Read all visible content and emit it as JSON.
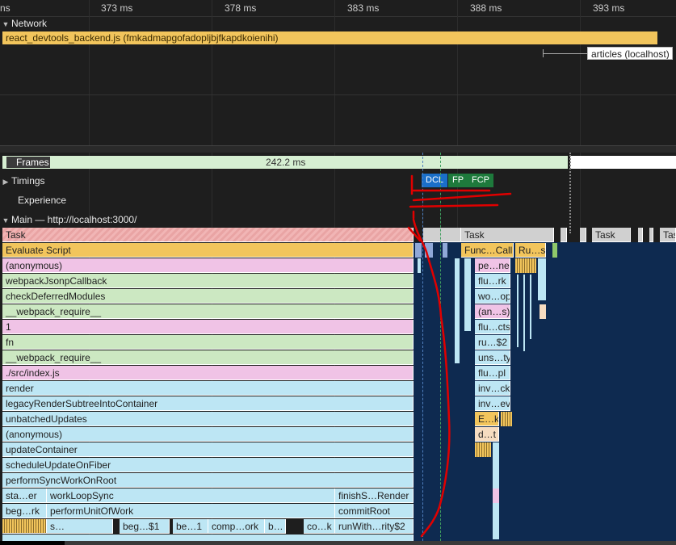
{
  "ruler": {
    "ticks": [
      "ns",
      "373 ms",
      "378 ms",
      "383 ms",
      "388 ms",
      "393 ms"
    ]
  },
  "network": {
    "title": "Network",
    "requests": [
      "react_devtools_backend.js (fmkadmapgofadopljbjfkapdkoienihi)",
      "articles (localhost)"
    ]
  },
  "frames": {
    "label": "Frames",
    "duration": "242.2 ms"
  },
  "timings": {
    "label": "Timings",
    "markers": [
      "DCL",
      "FP",
      "FCP"
    ]
  },
  "experience": {
    "label": "Experience"
  },
  "main": {
    "title": "Main — http://localhost:3000/",
    "task_label": "Task",
    "right_tasks": [
      "Task",
      "Task",
      "Tas"
    ],
    "stack": [
      "Evaluate Script",
      "(anonymous)",
      "webpackJsonpCallback",
      "checkDeferredModules",
      "__webpack_require__",
      "1",
      "fn",
      "__webpack_require__",
      "./src/index.js",
      "render",
      "legacyRenderSubtreeIntoContainer",
      "unbatchedUpdates",
      "(anonymous)",
      "updateContainer",
      "scheduleUpdateOnFiber",
      "performSyncWorkOnRoot"
    ],
    "row17": [
      "sta…er",
      "workLoopSync",
      "finishS…Render"
    ],
    "row18": [
      "beg…rk",
      "performUnitOfWork",
      "commitRoot"
    ],
    "row19": [
      "s…",
      "beg…$1",
      "be…1",
      "comp…ork",
      "b…",
      "co…k",
      "runWith…rity$2"
    ],
    "mid_col_top": [
      "Func…Call",
      "Ru…s"
    ],
    "mid_col": [
      "pe…ne",
      "flu…rk",
      "wo…op",
      "(an…s)",
      "flu…cts",
      "ru…$2",
      "uns…ty",
      "flu…pl",
      "inv…ck",
      "inv…ev",
      "E…k",
      "d…t"
    ]
  },
  "colors": {
    "script": "#f2c55c",
    "dcl": "#1a6fc9",
    "fp": "#1e7a3c",
    "fcp": "#1e7a3c",
    "annotation": "#e00000"
  }
}
